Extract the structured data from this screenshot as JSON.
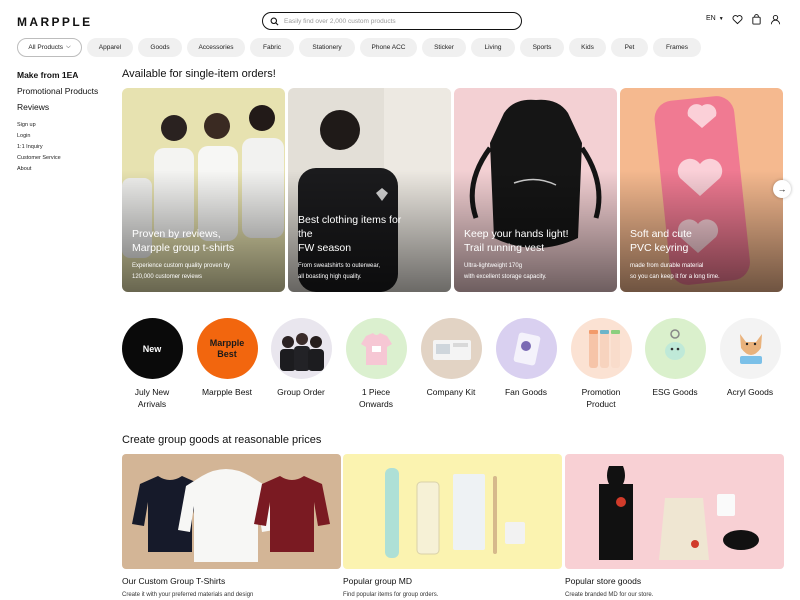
{
  "header": {
    "logo": "MARPPLE",
    "search_placeholder": "Easily find over 2,000 custom products",
    "language": "EN",
    "icons": [
      "search-icon",
      "heart-icon",
      "cart-icon",
      "user-icon"
    ]
  },
  "categories": {
    "all": "All Products",
    "items": [
      "Apparel",
      "Goods",
      "Accessories",
      "Fabric",
      "Stationery",
      "Phone ACC",
      "Sticker",
      "Living",
      "Sports",
      "Kids",
      "Pet",
      "Frames"
    ]
  },
  "sidebar": {
    "main": [
      "Make from 1EA",
      "Promotional Products",
      "Reviews"
    ],
    "links": [
      "Sign up",
      "Login",
      "1:1 Inquiry",
      "Customer Service",
      "About"
    ]
  },
  "hero": {
    "title": "Available for single-item orders!",
    "cards": [
      {
        "title": "Proven by reviews,\nMarpple group t-shirts",
        "desc": "Experience custom quality proven by\n120,000 customer reviews"
      },
      {
        "title": "Best clothing items for\nthe\nFW season",
        "desc": "From sweatshirts to outerwear,\nall boasting high quality."
      },
      {
        "title": "Keep your hands light!\nTrail running vest",
        "desc": "Ultra-lightweight 170g\nwith excellent storage capacity."
      },
      {
        "title": "Soft and cute\nPVC keyring",
        "desc": "made from durable material\nso you can keep it for a long time."
      }
    ]
  },
  "circles": [
    {
      "label": "July New\nArrivals",
      "badge": "New"
    },
    {
      "label": "Marpple Best",
      "badge": "Marpple\nBest"
    },
    {
      "label": "Group Order"
    },
    {
      "label": "1 Piece\nOnwards"
    },
    {
      "label": "Company Kit"
    },
    {
      "label": "Fan Goods"
    },
    {
      "label": "Promotion\nProduct"
    },
    {
      "label": "ESG Goods"
    },
    {
      "label": "Acryl Goods"
    }
  ],
  "group": {
    "title": "Create group goods at reasonable prices",
    "cards": [
      {
        "title": "Our Custom Group T-Shirts",
        "desc": "Create it with your preferred materials and design"
      },
      {
        "title": "Popular group MD",
        "desc": "Find popular items for group orders."
      },
      {
        "title": "Popular store goods",
        "desc": "Create branded MD for our store."
      }
    ]
  },
  "colors": {
    "orange": "#f2660e",
    "black": "#111111",
    "pill_bg": "#f0f0f0"
  }
}
